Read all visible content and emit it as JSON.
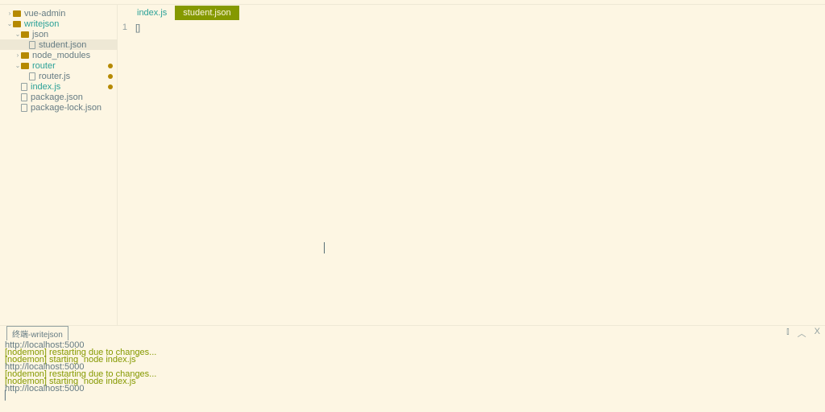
{
  "sidebar": {
    "items": [
      {
        "label": "vue-admin"
      },
      {
        "label": "writejson"
      },
      {
        "label": "json"
      },
      {
        "label": "student.json"
      },
      {
        "label": "node_modules"
      },
      {
        "label": "router"
      },
      {
        "label": "router.js"
      },
      {
        "label": "index.js"
      },
      {
        "label": "package.json"
      },
      {
        "label": "package-lock.json"
      }
    ]
  },
  "tabs": {
    "inactive": "index.js",
    "active": "student.json"
  },
  "editor": {
    "line_no": "1",
    "content": "[]"
  },
  "terminal": {
    "tab": "终端-writejson",
    "lines": [
      {
        "cls": "t-plain",
        "text": "http://localhost:5000"
      },
      {
        "cls": "t-green",
        "text": "[nodemon] restarting due to changes..."
      },
      {
        "cls": "t-green",
        "text": "[nodemon] starting `node index.js`"
      },
      {
        "cls": "t-plain",
        "text": "http://localhost:5000"
      },
      {
        "cls": "t-green",
        "text": "[nodemon] restarting due to changes..."
      },
      {
        "cls": "t-green",
        "text": "[nodemon] starting `node index.js`"
      },
      {
        "cls": "t-plain",
        "text": "http://localhost:5000"
      },
      {
        "cls": "t-caret",
        "text": "▏"
      }
    ],
    "ctrl_split": "⫾",
    "ctrl_up": "︿",
    "ctrl_close": "X"
  }
}
